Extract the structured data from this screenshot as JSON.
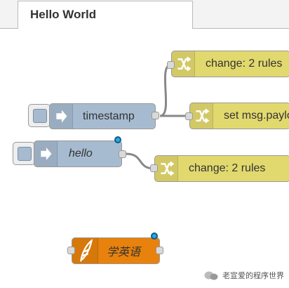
{
  "colors": {
    "inject_node": "#a6bbcf",
    "change_node": "#e2d96e",
    "custom_node": "#e8820c",
    "wire": "#888888",
    "status_dot": "#2fa6e0"
  },
  "tabs": [
    {
      "label": "Hello World",
      "active": true
    }
  ],
  "nodes": {
    "timestamp": {
      "label": "timestamp",
      "type": "inject",
      "icon": "arrow-in-icon"
    },
    "change1": {
      "label": "change: 2 rules",
      "type": "change",
      "icon": "shuffle-icon"
    },
    "setmsg": {
      "label": "set msg.payload",
      "type": "change",
      "icon": "shuffle-icon"
    },
    "hello": {
      "label": "hello",
      "type": "inject",
      "icon": "arrow-in-icon"
    },
    "change2": {
      "label": "change: 2 rules",
      "type": "change",
      "icon": "shuffle-icon"
    },
    "custom": {
      "label": "学英语",
      "type": "custom",
      "icon": "feather-icon"
    }
  },
  "watermark": {
    "text": "老宣爱的程序世界"
  }
}
